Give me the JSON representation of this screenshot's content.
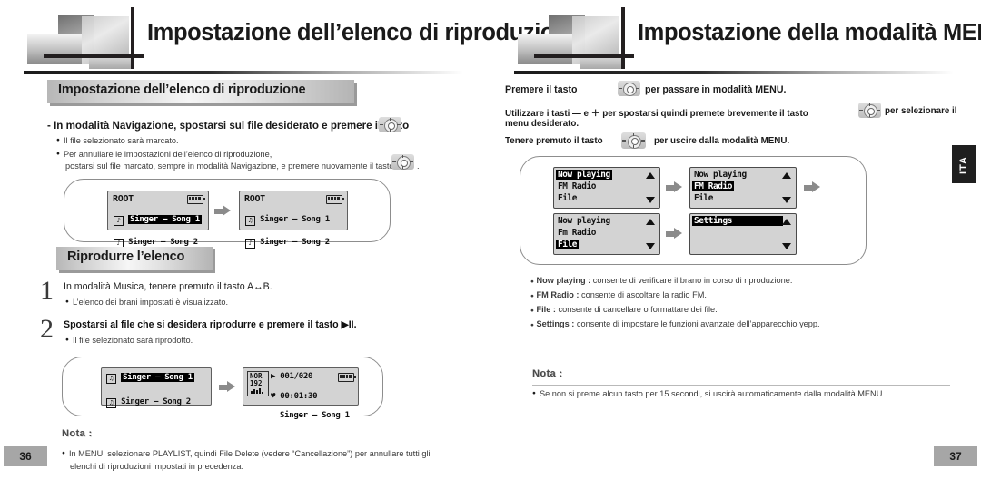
{
  "left_page": {
    "banner_title": "Impostazione dell’elenco di riproduzione",
    "section1_title": "Impostazione dell’elenco di riproduzione",
    "lead": "- In modalità Navigazione, spostarsi sul file desiderato e premere il tasto",
    "lead_suffix": ".",
    "bullet1": "Il file selezionato sarà marcato.",
    "bullet2": "Per annullare le impostazioni dell’elenco di riproduzione,",
    "bullet2_cont": "postarsi sul file marcato, sempre in modalità Navigazione, e premere nuovamente il tasto",
    "bullet2_suffix": ".",
    "lcd1": {
      "title": "ROOT",
      "line1": "Singer – Song 1",
      "line2": "Singer – Song 2"
    },
    "lcd2": {
      "title": "ROOT",
      "line1": "Singer – Song 1",
      "line2": "Singer – Song 2"
    },
    "section2_title": "Riprodurre l’elenco",
    "step1_num": "1",
    "step1_text": "In modalità Musica, tenere premuto il tasto A↔B.",
    "step1_bullet": "L’elenco dei brani impostati è visualizzato.",
    "step2_num": "2",
    "step2_text": "Spostarsi al file che si desidera riprodurre e premere il tasto ▶II.",
    "step2_bullet": "Il file selezionato sarà riprodotto.",
    "lcd3": {
      "line1": "Singer – Song 1",
      "line2": "Singer – Song 2"
    },
    "lcd4": {
      "tag1": "NOR",
      "tag2": "192",
      "track": "001/020",
      "time": "00:01:30",
      "song": "Singer – Song 1"
    },
    "nota_label": "Nota :",
    "nota_line1": "In MENU, selezionare PLAYLIST, quindi File Delete (vedere “Cancellazione”) per annullare tutti gli",
    "nota_line2": "elenchi di riproduzioni impostati in precedenza.",
    "page_number": "36"
  },
  "right_page": {
    "banner_title": "Impostazione della modalità MENU",
    "intro1_a": "Premere il tasto",
    "intro1_b": "per passare in modalità MENU.",
    "intro2_a": "Utilizzare i tasti — e ＋ per spostarsi quindi premete brevemente il tasto",
    "intro2_b": "per selezionare il",
    "intro2_c": "menu desiderato.",
    "intro3_a": "Tenere premuto il tasto",
    "intro3_b": "per uscire dalla modalità MENU.",
    "menu_screens": [
      {
        "items": [
          "Now playing",
          "FM Radio",
          "File"
        ],
        "selected": 0
      },
      {
        "items": [
          "Now playing",
          "FM Radio",
          "File"
        ],
        "selected": 1
      },
      {
        "items": [
          "Now playing",
          "Fm Radio",
          "File"
        ],
        "selected": 2
      },
      {
        "items": [
          "Settings",
          "",
          ""
        ],
        "selected": 0
      }
    ],
    "bullets": [
      {
        "term": "Now playing",
        "sep": " : ",
        "desc": "consente di verificare il brano in corso di riproduzione."
      },
      {
        "term": "FM Radio",
        "sep": " : ",
        "desc": "consente di ascoltare la radio FM."
      },
      {
        "term": "File",
        "sep": " : ",
        "desc": "consente di cancellare o formattare dei file."
      },
      {
        "term": "Settings",
        "sep": " : ",
        "desc": "consente di impostare le funzioni avanzate dell’apparecchio yepp."
      }
    ],
    "nota_label": "Nota :",
    "nota_line1": "Se non si preme alcun tasto per 15 secondi, si uscirà automaticamente dalla modalità MENU.",
    "page_number": "37"
  },
  "side_tab": {
    "label": "ITA"
  },
  "colors": {
    "lcd_bg": "#d3d3d3",
    "highlight": "#000000",
    "tab_bg": "#1f1f1f",
    "pagenum_bg": "#a6a6a6"
  }
}
